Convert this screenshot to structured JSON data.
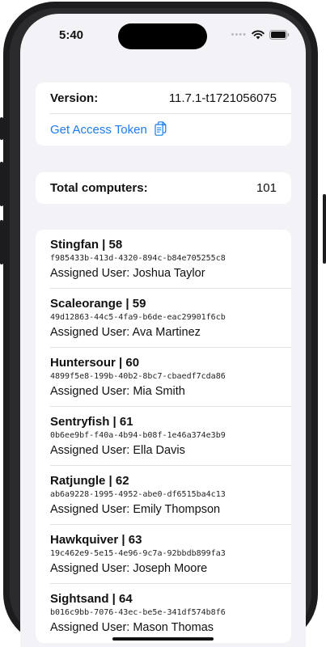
{
  "status_bar": {
    "time": "5:40"
  },
  "version_card": {
    "version_label": "Version:",
    "version_value": "11.7.1-t1721056075",
    "access_token_label": "Get Access Token"
  },
  "total_card": {
    "label": "Total computers:",
    "value": "101"
  },
  "computers": [
    {
      "name": "Stingfan | 58",
      "id": "f985433b-413d-4320-894c-b84e705255c8",
      "assigned": "Assigned User:  Joshua Taylor"
    },
    {
      "name": "Scaleorange | 59",
      "id": "49d12863-44c5-4fa9-b6de-eac29901f6cb",
      "assigned": "Assigned User:  Ava Martinez"
    },
    {
      "name": "Huntersour | 60",
      "id": "4899f5e8-199b-40b2-8bc7-cbaedf7cda86",
      "assigned": "Assigned User:  Mia Smith"
    },
    {
      "name": "Sentryfish | 61",
      "id": "0b6ee9bf-f40a-4b94-b08f-1e46a374e3b9",
      "assigned": "Assigned User:  Ella Davis"
    },
    {
      "name": "Ratjungle | 62",
      "id": "ab6a9228-1995-4952-abe0-df6515ba4c13",
      "assigned": "Assigned User:  Emily Thompson"
    },
    {
      "name": "Hawkquiver | 63",
      "id": "19c462e9-5e15-4e96-9c7a-92bbdb899fa3",
      "assigned": "Assigned User:  Joseph Moore"
    },
    {
      "name": "Sightsand | 64",
      "id": "b016c9bb-7076-43ec-be5e-341df574b8f6",
      "assigned": "Assigned User:  Mason Thomas"
    }
  ],
  "colors": {
    "accent": "#1a7cf0",
    "background": "#f2f2f7",
    "card": "#ffffff"
  },
  "icons": [
    "wifi-icon",
    "battery-icon",
    "copy-icon"
  ]
}
